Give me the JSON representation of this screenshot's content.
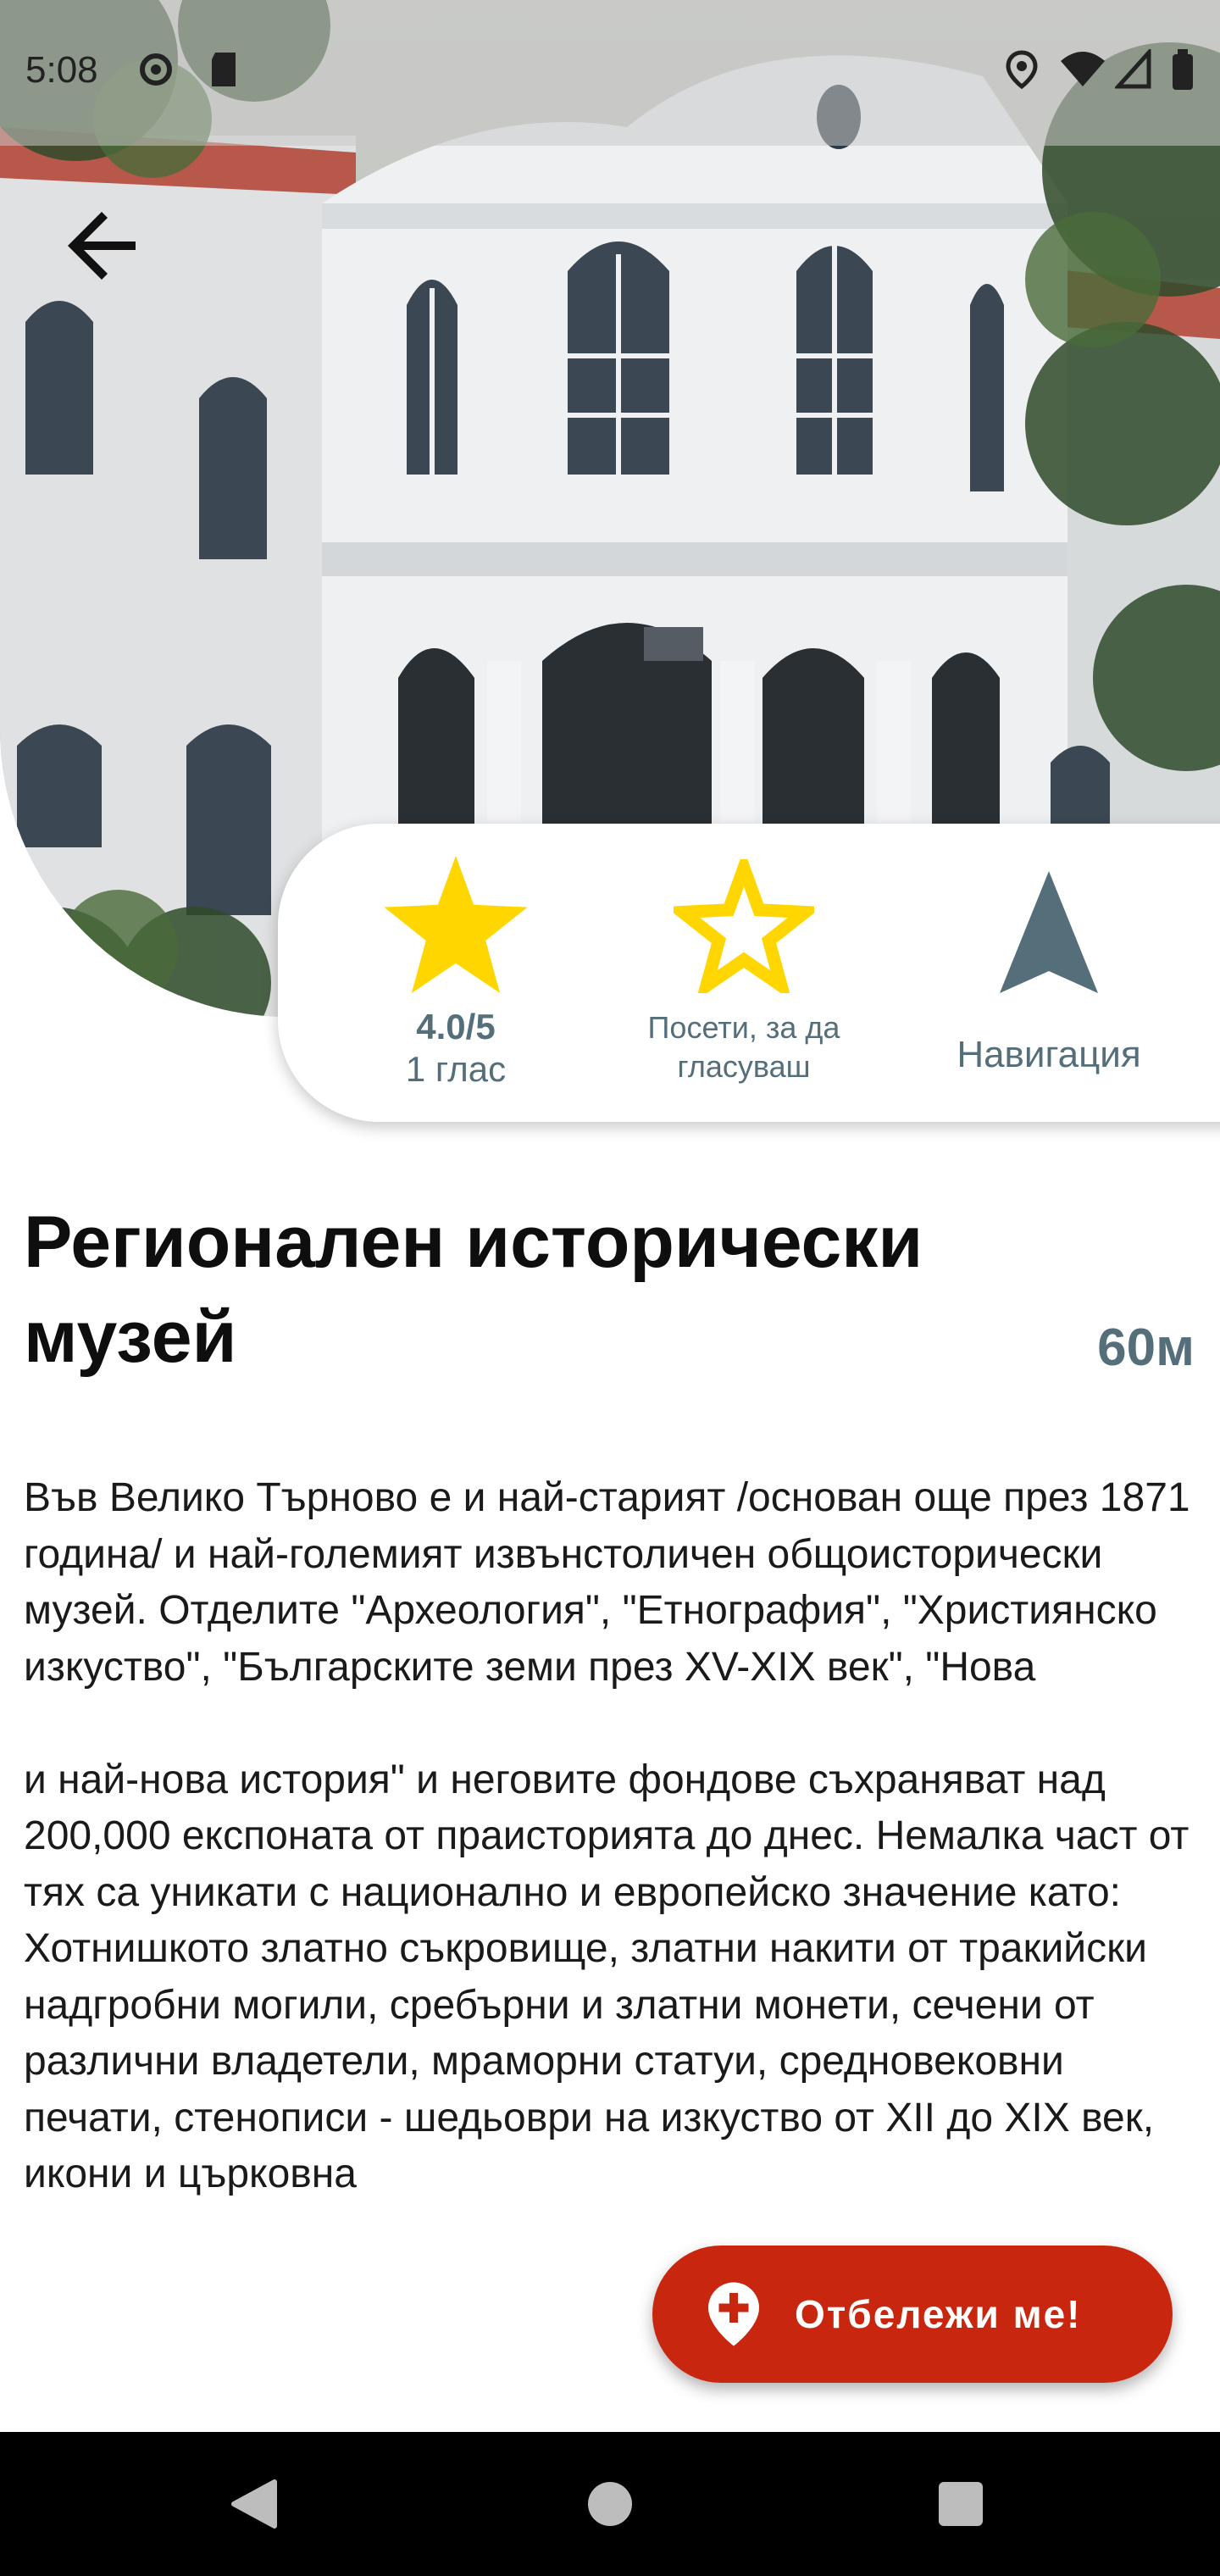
{
  "status_bar": {
    "time": "5:08",
    "icons": [
      "settings-gear-icon",
      "sd-card-icon",
      "location-icon",
      "wifi-icon",
      "signal-icon",
      "battery-icon"
    ]
  },
  "hero": {
    "image": "photo of a white historic museum building with arched windows and trees"
  },
  "actions": {
    "rating": {
      "value": "4.0/5",
      "votes": "1 глас",
      "icon": "star-filled-icon"
    },
    "visit": {
      "label": "Посети, за да гласуваш",
      "icon": "star-outline-icon"
    },
    "navigation": {
      "label": "Навигация",
      "icon": "navigation-arrow-icon"
    }
  },
  "place": {
    "title": "Регионален исторически музей",
    "distance": "60м",
    "description": "Във Велико Търново е и най-старият /основан още през 1871 година/ и най-големият извънстоличен общоисторически музей. Отделите \"Археология\", \"Етнография\", \"Християнско изкуство\", \"Българските земи през XV-XIX век\", \"Нова\n\nи най-нова история\" и неговите фондове съхраняват над 200,000 експоната от праисторията до днес. Немалка част от тях са уникати с национално и европейско значение като: Хотнишкото златно съкровище, златни накити от тракийски надгробни могили, сребърни и златни монети, сечени от различни владетели, мраморни статуи, средновековни печати, стенописи - шедьоври на изкуство от XII до XIX век, икони и църковна"
  },
  "fab": {
    "label": "Отбележи ме!",
    "icon": "add-location-icon"
  },
  "colors": {
    "accent_gray": "#546e7a",
    "star_yellow": "#ffd600",
    "fab_red": "#c8260e"
  }
}
